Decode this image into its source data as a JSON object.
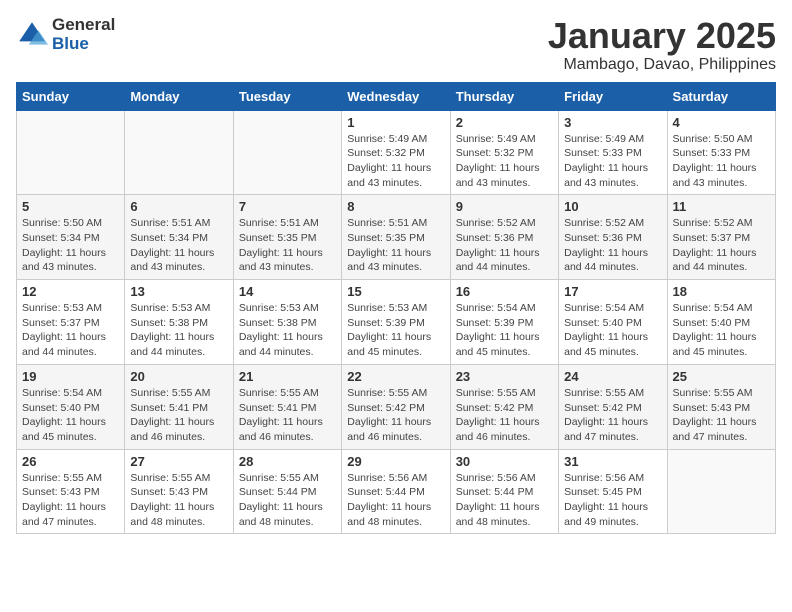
{
  "logo": {
    "general": "General",
    "blue": "Blue"
  },
  "header": {
    "title": "January 2025",
    "subtitle": "Mambago, Davao, Philippines"
  },
  "days_of_week": [
    "Sunday",
    "Monday",
    "Tuesday",
    "Wednesday",
    "Thursday",
    "Friday",
    "Saturday"
  ],
  "weeks": [
    [
      {
        "day": "",
        "info": ""
      },
      {
        "day": "",
        "info": ""
      },
      {
        "day": "",
        "info": ""
      },
      {
        "day": "1",
        "info": "Sunrise: 5:49 AM\nSunset: 5:32 PM\nDaylight: 11 hours and 43 minutes."
      },
      {
        "day": "2",
        "info": "Sunrise: 5:49 AM\nSunset: 5:32 PM\nDaylight: 11 hours and 43 minutes."
      },
      {
        "day": "3",
        "info": "Sunrise: 5:49 AM\nSunset: 5:33 PM\nDaylight: 11 hours and 43 minutes."
      },
      {
        "day": "4",
        "info": "Sunrise: 5:50 AM\nSunset: 5:33 PM\nDaylight: 11 hours and 43 minutes."
      }
    ],
    [
      {
        "day": "5",
        "info": "Sunrise: 5:50 AM\nSunset: 5:34 PM\nDaylight: 11 hours and 43 minutes."
      },
      {
        "day": "6",
        "info": "Sunrise: 5:51 AM\nSunset: 5:34 PM\nDaylight: 11 hours and 43 minutes."
      },
      {
        "day": "7",
        "info": "Sunrise: 5:51 AM\nSunset: 5:35 PM\nDaylight: 11 hours and 43 minutes."
      },
      {
        "day": "8",
        "info": "Sunrise: 5:51 AM\nSunset: 5:35 PM\nDaylight: 11 hours and 43 minutes."
      },
      {
        "day": "9",
        "info": "Sunrise: 5:52 AM\nSunset: 5:36 PM\nDaylight: 11 hours and 44 minutes."
      },
      {
        "day": "10",
        "info": "Sunrise: 5:52 AM\nSunset: 5:36 PM\nDaylight: 11 hours and 44 minutes."
      },
      {
        "day": "11",
        "info": "Sunrise: 5:52 AM\nSunset: 5:37 PM\nDaylight: 11 hours and 44 minutes."
      }
    ],
    [
      {
        "day": "12",
        "info": "Sunrise: 5:53 AM\nSunset: 5:37 PM\nDaylight: 11 hours and 44 minutes."
      },
      {
        "day": "13",
        "info": "Sunrise: 5:53 AM\nSunset: 5:38 PM\nDaylight: 11 hours and 44 minutes."
      },
      {
        "day": "14",
        "info": "Sunrise: 5:53 AM\nSunset: 5:38 PM\nDaylight: 11 hours and 44 minutes."
      },
      {
        "day": "15",
        "info": "Sunrise: 5:53 AM\nSunset: 5:39 PM\nDaylight: 11 hours and 45 minutes."
      },
      {
        "day": "16",
        "info": "Sunrise: 5:54 AM\nSunset: 5:39 PM\nDaylight: 11 hours and 45 minutes."
      },
      {
        "day": "17",
        "info": "Sunrise: 5:54 AM\nSunset: 5:40 PM\nDaylight: 11 hours and 45 minutes."
      },
      {
        "day": "18",
        "info": "Sunrise: 5:54 AM\nSunset: 5:40 PM\nDaylight: 11 hours and 45 minutes."
      }
    ],
    [
      {
        "day": "19",
        "info": "Sunrise: 5:54 AM\nSunset: 5:40 PM\nDaylight: 11 hours and 45 minutes."
      },
      {
        "day": "20",
        "info": "Sunrise: 5:55 AM\nSunset: 5:41 PM\nDaylight: 11 hours and 46 minutes."
      },
      {
        "day": "21",
        "info": "Sunrise: 5:55 AM\nSunset: 5:41 PM\nDaylight: 11 hours and 46 minutes."
      },
      {
        "day": "22",
        "info": "Sunrise: 5:55 AM\nSunset: 5:42 PM\nDaylight: 11 hours and 46 minutes."
      },
      {
        "day": "23",
        "info": "Sunrise: 5:55 AM\nSunset: 5:42 PM\nDaylight: 11 hours and 46 minutes."
      },
      {
        "day": "24",
        "info": "Sunrise: 5:55 AM\nSunset: 5:42 PM\nDaylight: 11 hours and 47 minutes."
      },
      {
        "day": "25",
        "info": "Sunrise: 5:55 AM\nSunset: 5:43 PM\nDaylight: 11 hours and 47 minutes."
      }
    ],
    [
      {
        "day": "26",
        "info": "Sunrise: 5:55 AM\nSunset: 5:43 PM\nDaylight: 11 hours and 47 minutes."
      },
      {
        "day": "27",
        "info": "Sunrise: 5:55 AM\nSunset: 5:43 PM\nDaylight: 11 hours and 48 minutes."
      },
      {
        "day": "28",
        "info": "Sunrise: 5:55 AM\nSunset: 5:44 PM\nDaylight: 11 hours and 48 minutes."
      },
      {
        "day": "29",
        "info": "Sunrise: 5:56 AM\nSunset: 5:44 PM\nDaylight: 11 hours and 48 minutes."
      },
      {
        "day": "30",
        "info": "Sunrise: 5:56 AM\nSunset: 5:44 PM\nDaylight: 11 hours and 48 minutes."
      },
      {
        "day": "31",
        "info": "Sunrise: 5:56 AM\nSunset: 5:45 PM\nDaylight: 11 hours and 49 minutes."
      },
      {
        "day": "",
        "info": ""
      }
    ]
  ]
}
